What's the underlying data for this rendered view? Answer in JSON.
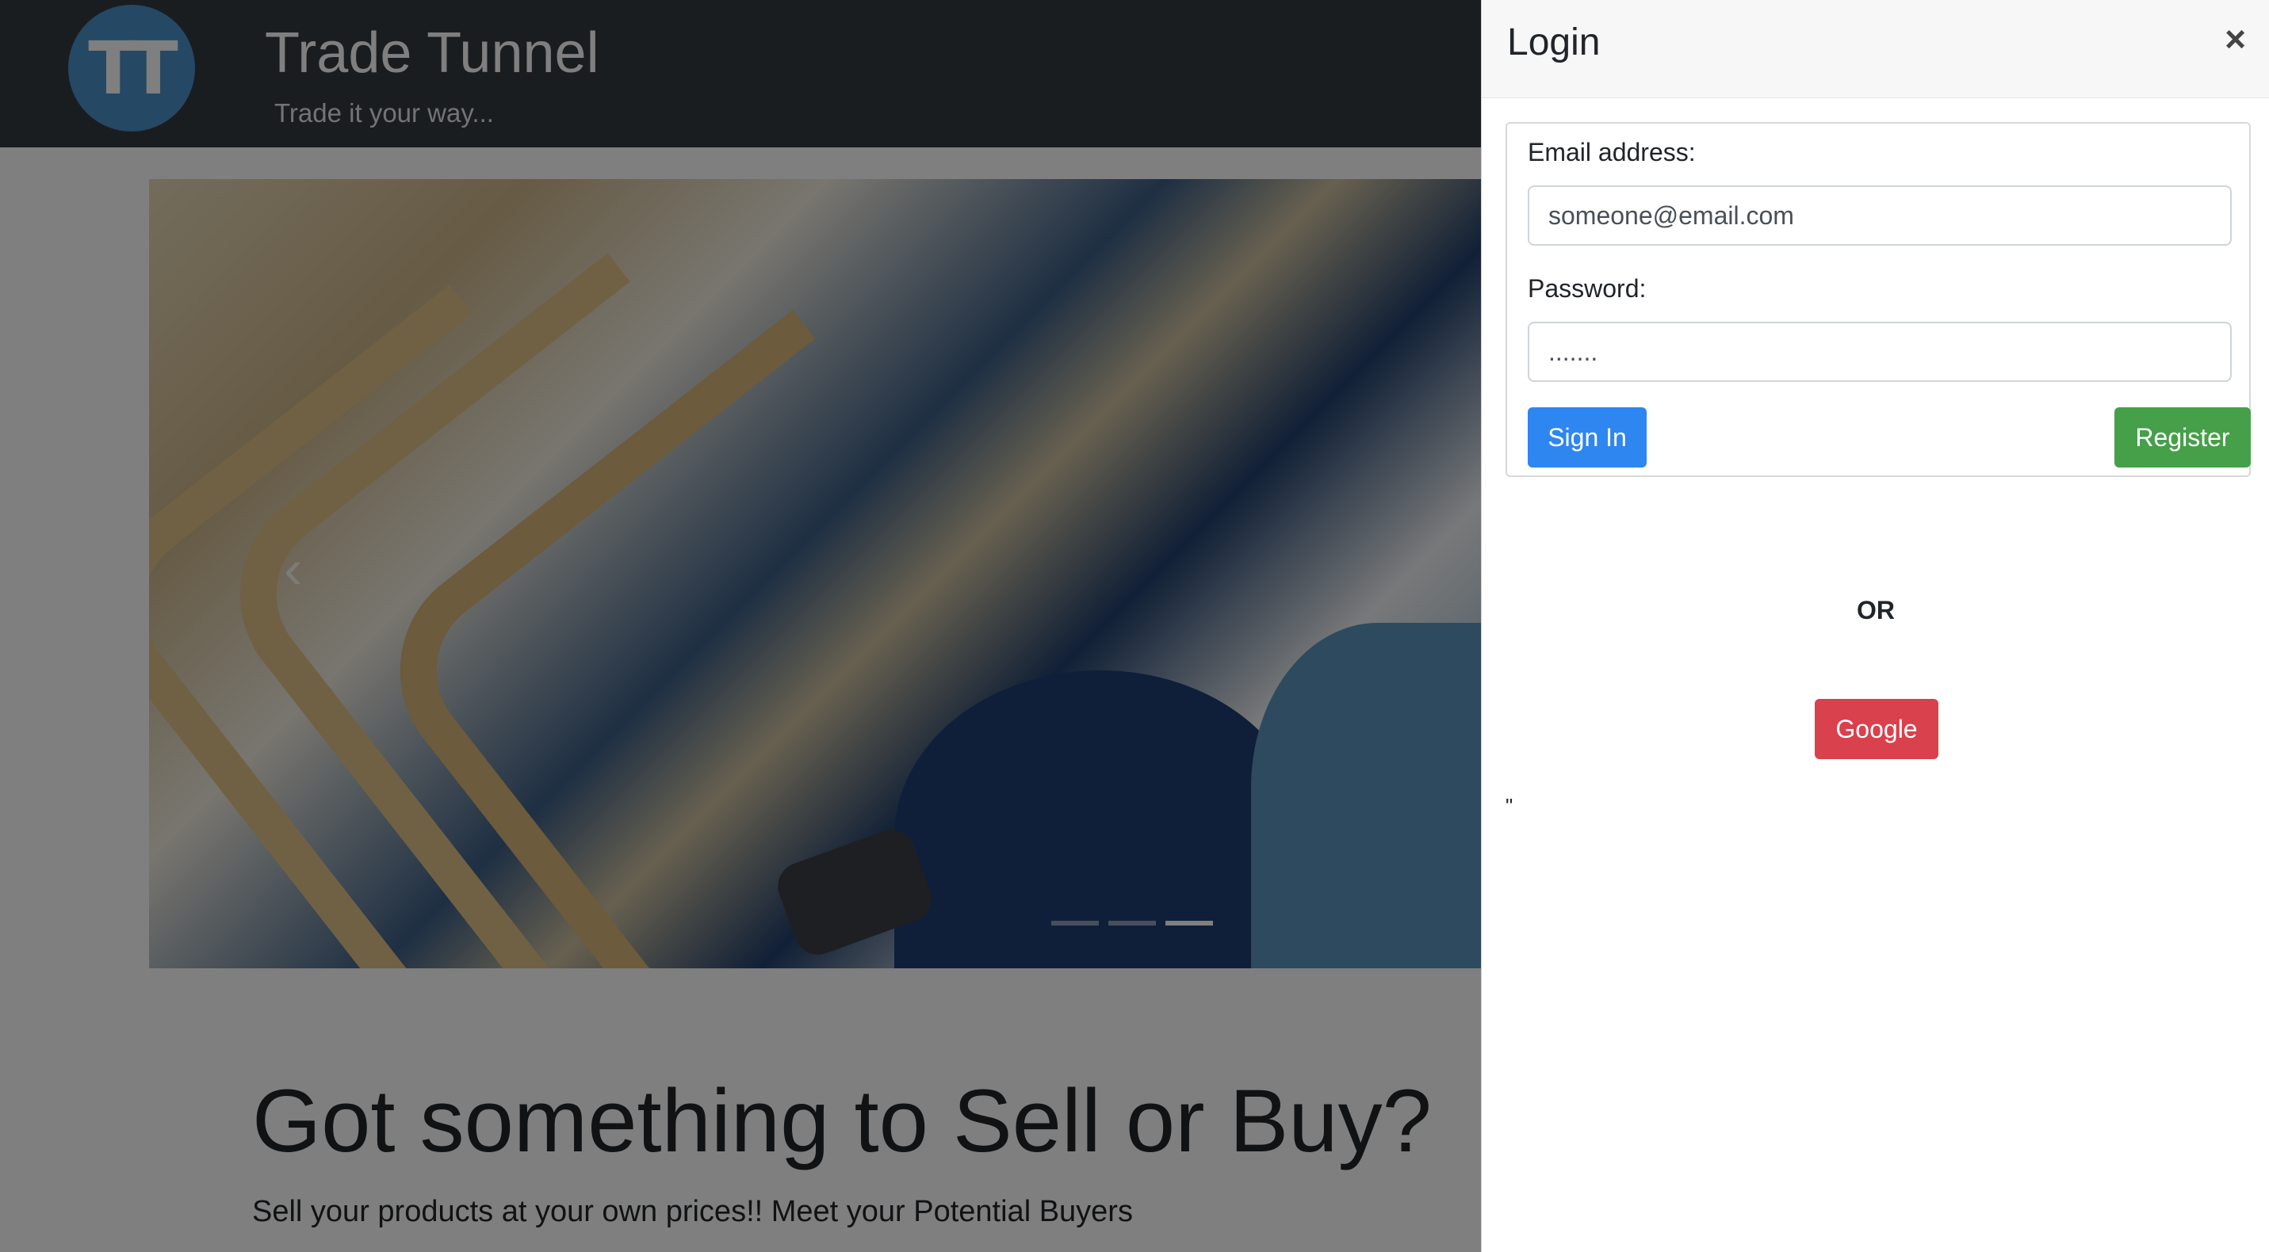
{
  "header": {
    "logo_text": "TT",
    "title": "Trade Tunnel",
    "tagline": "Trade it your way..."
  },
  "carousel": {
    "prev_icon": "chevron-left-icon",
    "prev_glyph": "‹",
    "indicator_count": 3,
    "active_indicator": 3
  },
  "hero": {
    "title": "Got something to Sell or Buy?",
    "subtitle": "Sell your products at your own prices!! Meet your Potential Buyers"
  },
  "login": {
    "title": "Login",
    "close_glyph": "×",
    "email_label": "Email address:",
    "email_value": "someone@email.com",
    "password_label": "Password:",
    "password_value": ".......",
    "signin_label": "Sign In",
    "register_label": "Register",
    "or_text": "OR",
    "google_label": "Google",
    "stray_text": "\""
  },
  "colors": {
    "topbar": "#343a40",
    "signin": "#2e86f0",
    "register": "#46a049",
    "google": "#d9414d"
  }
}
